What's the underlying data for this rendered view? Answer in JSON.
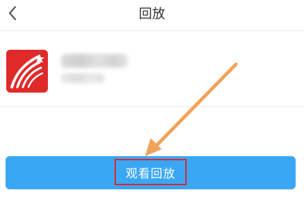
{
  "header": {
    "title": "回放",
    "back_icon": "chevron-left-icon"
  },
  "item": {
    "app_icon": "xuexitong-logo-icon"
  },
  "actions": {
    "watch_replay_label": "观看回放"
  },
  "annotation": {
    "arrow_color": "#f0a35a",
    "highlight_color": "#e0232a"
  },
  "colors": {
    "primary_button": "#3aa7f5",
    "logo_red": "#e02a2a"
  }
}
